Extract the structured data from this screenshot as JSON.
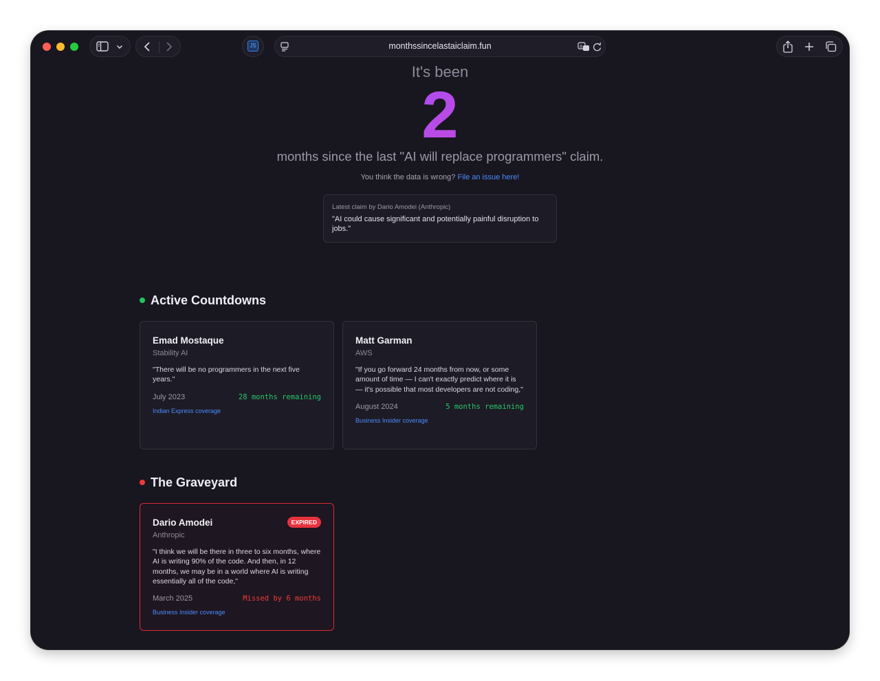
{
  "browser": {
    "url": "monthssincelastaiclaim.fun",
    "extension_label": "JS"
  },
  "hero": {
    "intro": "It's been",
    "count": "2",
    "headline": "months since the last \"AI will replace programmers\" claim.",
    "wrong_text": "You think the data is wrong?",
    "wrong_link": "File an issue here!"
  },
  "latest": {
    "label": "Latest claim by Dario Amodei (Anthropic)",
    "quote": "\"AI could cause significant and potentially painful disruption to jobs.\""
  },
  "active": {
    "title": "Active Countdowns",
    "cards": [
      {
        "name": "Emad Mostaque",
        "org": "Stability AI",
        "quote": "\"There will be no programmers in the next five years.\"",
        "date": "July 2023",
        "remaining": "28 months remaining",
        "link": "Indian Express coverage"
      },
      {
        "name": "Matt Garman",
        "org": "AWS",
        "quote": "\"If you go forward 24 months from now, or some amount of time — I can't exactly predict where it is — it's possible that most developers are not coding,\"",
        "date": "August 2024",
        "remaining": "5 months remaining",
        "link": "Business Insider coverage"
      }
    ]
  },
  "graveyard": {
    "title": "The Graveyard",
    "cards": [
      {
        "name": "Dario Amodei",
        "org": "Anthropic",
        "badge": "EXPIRED",
        "quote": "\"I think we will be there in three to six months, where AI is writing 90% of the code. And then, in 12 months, we may be in a world where AI is writing essentially all of the code,\"",
        "date": "March 2025",
        "remaining": "Missed by 6 months",
        "link": "Business Insider coverage"
      }
    ]
  },
  "colors": {
    "background": "#18161f",
    "accent_link": "#4b8cff",
    "active_green": "#22c55e",
    "expired_red": "#ef3b3b"
  }
}
